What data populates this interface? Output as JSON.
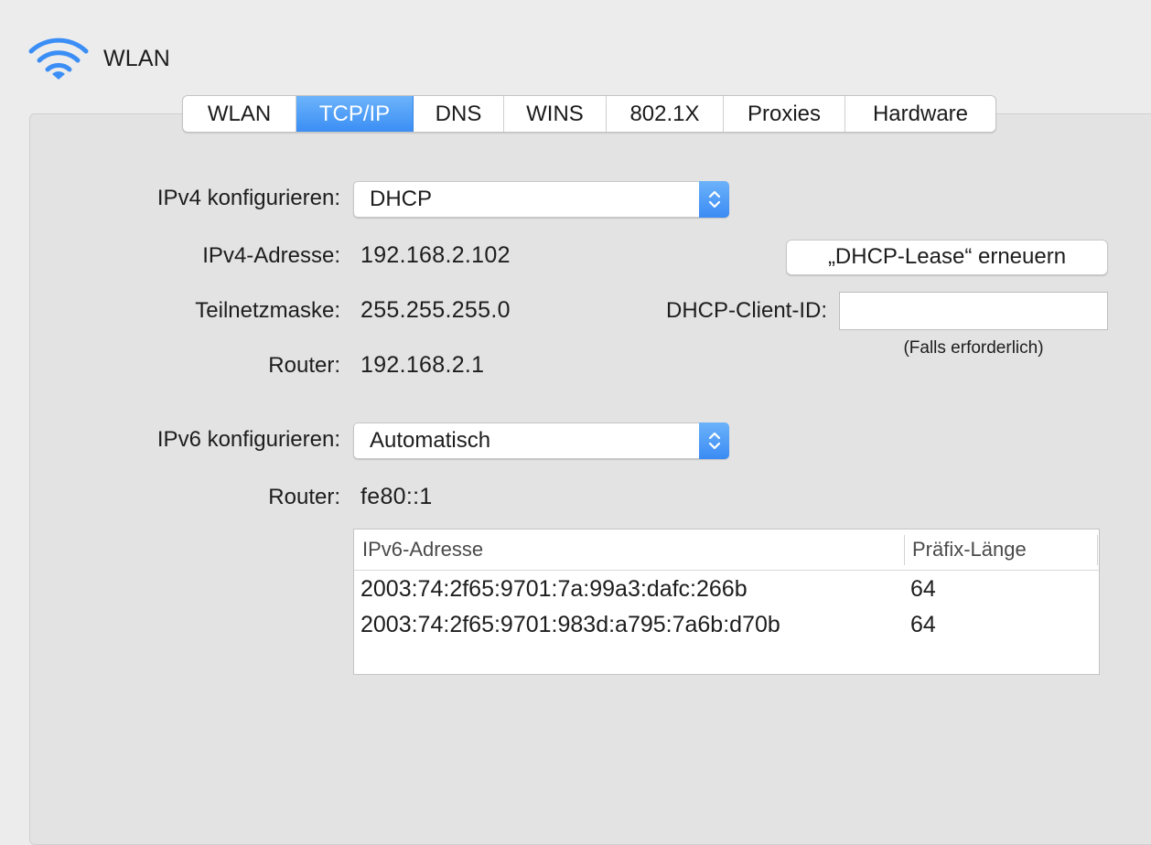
{
  "header": {
    "title": "WLAN",
    "icon": "wifi-icon",
    "icon_color": "#3b8ef5"
  },
  "tabs": [
    {
      "label": "WLAN",
      "active": false
    },
    {
      "label": "TCP/IP",
      "active": true
    },
    {
      "label": "DNS",
      "active": false
    },
    {
      "label": "WINS",
      "active": false
    },
    {
      "label": "802.1X",
      "active": false
    },
    {
      "label": "Proxies",
      "active": false
    },
    {
      "label": "Hardware",
      "active": false
    }
  ],
  "ipv4": {
    "configure_label": "IPv4 konfigurieren:",
    "configure_value": "DHCP",
    "address_label": "IPv4-Adresse:",
    "address_value": "192.168.2.102",
    "subnet_label": "Teilnetzmaske:",
    "subnet_value": "255.255.255.0",
    "router_label": "Router:",
    "router_value": "192.168.2.1"
  },
  "dhcp": {
    "renew_button": "„DHCP-Lease“ erneuern",
    "client_id_label": "DHCP-Client-ID:",
    "client_id_value": "",
    "client_id_hint": "(Falls erforderlich)"
  },
  "ipv6": {
    "configure_label": "IPv6 konfigurieren:",
    "configure_value": "Automatisch",
    "router_label": "Router:",
    "router_value": "fe80::1",
    "table": {
      "columns": [
        "IPv6-Adresse",
        "Präfix-Länge"
      ],
      "rows": [
        [
          "2003:74:2f65:9701:7a:99a3:dafc:266b",
          "64"
        ],
        [
          "2003:74:2f65:9701:983d:a795:7a6b:d70b",
          "64"
        ]
      ]
    }
  },
  "colors": {
    "accent": "#3b8ef5",
    "background": "#ececec",
    "panel": "#e3e3e3"
  }
}
